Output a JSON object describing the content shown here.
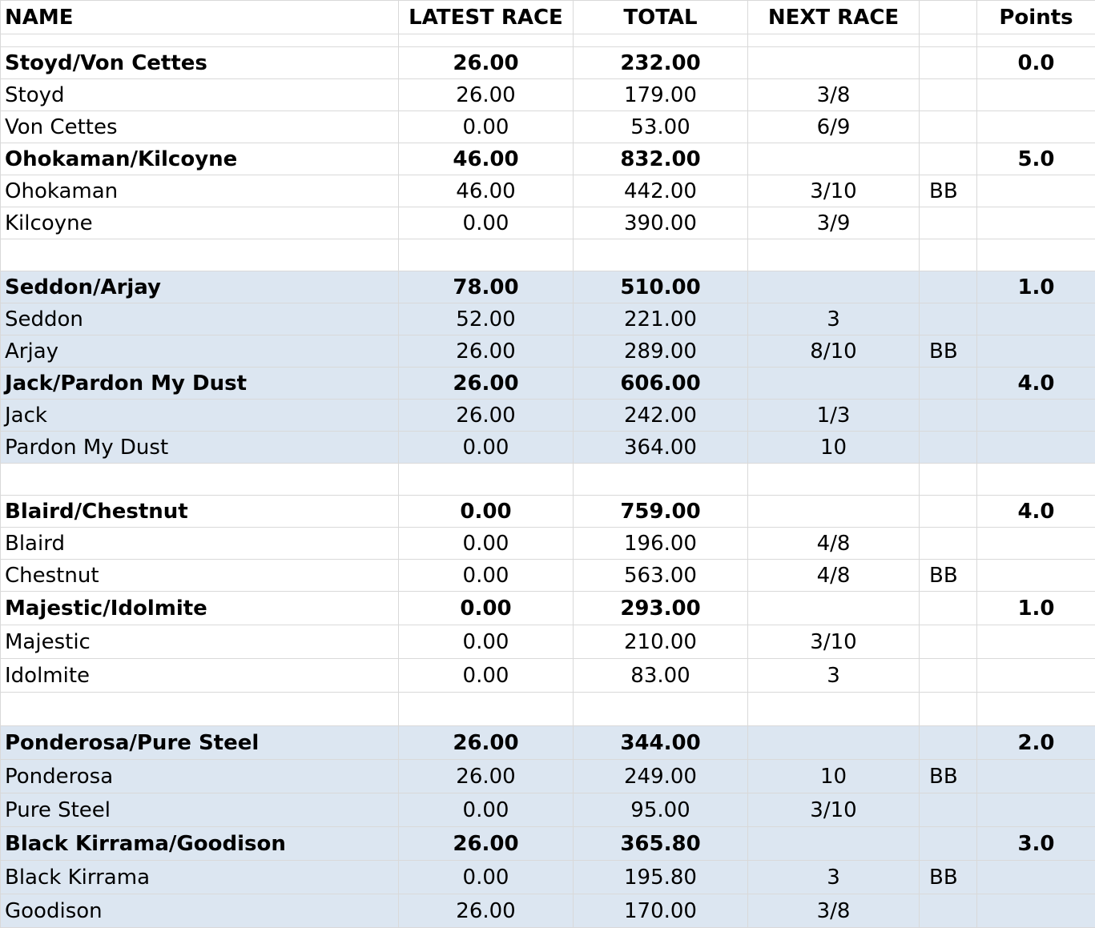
{
  "columns": [
    "NAME",
    "LATEST RACE",
    "TOTAL",
    "NEXT RACE",
    "",
    "Points"
  ],
  "rows": [
    {
      "kind": "spacer",
      "shaded": false,
      "h": 16,
      "cells": [
        "",
        "",
        "",
        "",
        "",
        ""
      ]
    },
    {
      "kind": "pair",
      "shaded": false,
      "h": 40,
      "cells": [
        "Stoyd/Von Cettes",
        "26.00",
        "232.00",
        "",
        "",
        "0.0"
      ]
    },
    {
      "kind": "horse",
      "shaded": false,
      "h": 40,
      "cells": [
        "Stoyd",
        "26.00",
        "179.00",
        "3/8",
        "",
        ""
      ]
    },
    {
      "kind": "horse",
      "shaded": false,
      "h": 40,
      "cells": [
        "Von Cettes",
        "0.00",
        "53.00",
        "6/9",
        "",
        ""
      ]
    },
    {
      "kind": "pair",
      "shaded": false,
      "h": 40,
      "cells": [
        "Ohokaman/Kilcoyne",
        "46.00",
        "832.00",
        "",
        "",
        "5.0"
      ]
    },
    {
      "kind": "horse",
      "shaded": false,
      "h": 40,
      "cells": [
        "Ohokaman",
        "46.00",
        "442.00",
        "3/10",
        "BB",
        ""
      ]
    },
    {
      "kind": "horse",
      "shaded": false,
      "h": 40,
      "cells": [
        "Kilcoyne",
        "0.00",
        "390.00",
        "3/9",
        "",
        ""
      ]
    },
    {
      "kind": "spacer",
      "shaded": false,
      "h": 40,
      "cells": [
        "",
        "",
        "",
        "",
        "",
        ""
      ]
    },
    {
      "kind": "pair",
      "shaded": true,
      "h": 40,
      "cells": [
        "Seddon/Arjay",
        "78.00",
        "510.00",
        "",
        "",
        "1.0"
      ]
    },
    {
      "kind": "horse",
      "shaded": true,
      "h": 40,
      "cells": [
        "Seddon",
        "52.00",
        "221.00",
        "3",
        "",
        ""
      ]
    },
    {
      "kind": "horse",
      "shaded": true,
      "h": 40,
      "cells": [
        "Arjay",
        "26.00",
        "289.00",
        "8/10",
        "BB",
        ""
      ]
    },
    {
      "kind": "pair",
      "shaded": true,
      "h": 40,
      "cells": [
        "Jack/Pardon My Dust",
        "26.00",
        "606.00",
        "",
        "",
        "4.0"
      ]
    },
    {
      "kind": "horse",
      "shaded": true,
      "h": 40,
      "cells": [
        "Jack",
        "26.00",
        "242.00",
        "1/3",
        "",
        ""
      ]
    },
    {
      "kind": "horse",
      "shaded": true,
      "h": 40,
      "cells": [
        "Pardon My Dust",
        "0.00",
        "364.00",
        "10",
        "",
        ""
      ]
    },
    {
      "kind": "spacer",
      "shaded": false,
      "h": 40,
      "cells": [
        "",
        "",
        "",
        "",
        "",
        ""
      ]
    },
    {
      "kind": "pair",
      "shaded": false,
      "h": 40,
      "cells": [
        "Blaird/Chestnut",
        "0.00",
        "759.00",
        "",
        "",
        "4.0"
      ]
    },
    {
      "kind": "horse",
      "shaded": false,
      "h": 40,
      "cells": [
        "Blaird",
        "0.00",
        "196.00",
        "4/8",
        "",
        ""
      ]
    },
    {
      "kind": "horse",
      "shaded": false,
      "h": 40,
      "cells": [
        "Chestnut",
        "0.00",
        "563.00",
        "4/8",
        "BB",
        ""
      ]
    },
    {
      "kind": "pair",
      "shaded": false,
      "h": 42,
      "cells": [
        "Majestic/Idolmite",
        "0.00",
        "293.00",
        "",
        "",
        "1.0"
      ]
    },
    {
      "kind": "horse",
      "shaded": false,
      "h": 42,
      "cells": [
        "Majestic",
        "0.00",
        "210.00",
        "3/10",
        "",
        ""
      ]
    },
    {
      "kind": "horse",
      "shaded": false,
      "h": 42,
      "cells": [
        "Idolmite",
        "0.00",
        "83.00",
        "3",
        "",
        ""
      ]
    },
    {
      "kind": "spacer",
      "shaded": false,
      "h": 42,
      "cells": [
        "",
        "",
        "",
        "",
        "",
        ""
      ]
    },
    {
      "kind": "pair",
      "shaded": true,
      "h": 42,
      "cells": [
        "Ponderosa/Pure Steel",
        "26.00",
        "344.00",
        "",
        "",
        "2.0"
      ]
    },
    {
      "kind": "horse",
      "shaded": true,
      "h": 42,
      "cells": [
        "Ponderosa",
        "26.00",
        "249.00",
        "10",
        "BB",
        ""
      ]
    },
    {
      "kind": "horse",
      "shaded": true,
      "h": 42,
      "cells": [
        "Pure Steel",
        "0.00",
        "95.00",
        "3/10",
        "",
        ""
      ]
    },
    {
      "kind": "pair",
      "shaded": true,
      "h": 42,
      "cells": [
        "Black Kirrama/Goodison",
        "26.00",
        "365.80",
        "",
        "",
        "3.0"
      ]
    },
    {
      "kind": "horse",
      "shaded": true,
      "h": 42,
      "cells": [
        "Black Kirrama",
        "0.00",
        "195.80",
        "3",
        "BB",
        ""
      ]
    },
    {
      "kind": "horse",
      "shaded": true,
      "h": 42,
      "cells": [
        "Goodison",
        "26.00",
        "170.00",
        "3/8",
        "",
        ""
      ]
    }
  ],
  "colors": {
    "shade": "#dce6f1",
    "grid": "#d9d9d9"
  }
}
